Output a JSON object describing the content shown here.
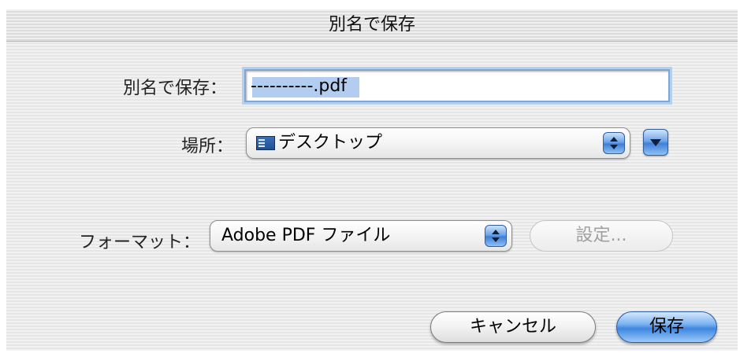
{
  "window": {
    "title": "別名で保存"
  },
  "save_as": {
    "label": "別名で保存：",
    "value": "----------.pdf"
  },
  "location": {
    "label": "場所：",
    "selected": "デスクトップ",
    "icon": "desktop-folder-icon"
  },
  "format": {
    "label": "フォーマット：",
    "selected": "Adobe PDF ファイル",
    "settings_label": "設定..."
  },
  "buttons": {
    "cancel": "キャンセル",
    "save": "保存"
  },
  "colors": {
    "accent": "#3e86e0",
    "selection": "#b3cdf0",
    "disabled_text": "#a0a0a0"
  }
}
